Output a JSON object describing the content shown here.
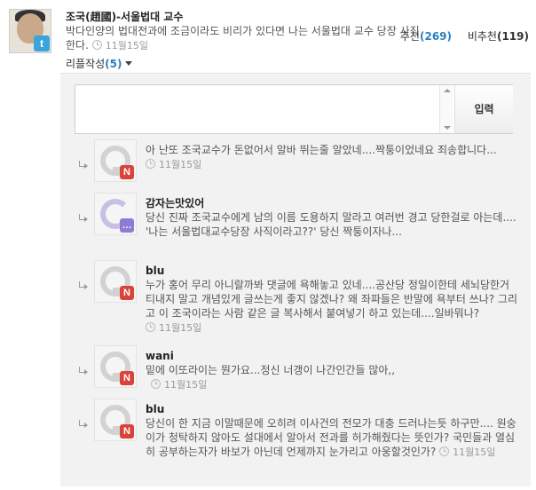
{
  "post": {
    "author": "조국(趙國)-서울법대 교수",
    "avatar_badge": "t",
    "text": "박다인양의 법대전과에 조금이라도 비리가 있다면 나는 서울법대 교수 당장 사직한다.",
    "time": "11월15일",
    "votes": {
      "up_label": "추천",
      "up_count": "(269)",
      "down_label": "비추천",
      "down_count": "(119)"
    }
  },
  "reply_toggle": {
    "label": "리플작성",
    "count": "(5)"
  },
  "reply_input": {
    "value": "",
    "submit_label": "입력"
  },
  "comments": [
    {
      "author": "",
      "badge": "N",
      "text": "아 난또 조국교수가 돈없어서 알바 뛰는줄 알았네....짝퉁이었네요 죄송합니다...",
      "time": "11월15일"
    },
    {
      "author": "감자는맛있어",
      "badge": "…",
      "text": "당신 진짜 조국교수에게 남의 이름 도용하지 말라고 여러번 경고 당한걸로 아는데.... '나는 서울법대교수당장 사직이라고??' 당신 짝퉁이자나...",
      "time": ""
    },
    {
      "author": "blu",
      "badge": "N",
      "text": "누가 홍어 무리 아니랄까봐 댓글에 욕해놓고 있네....공산당 정일이한테 세뇌당한거 티내지 말고 개념있게 글쓰는게 좋지 않겠나? 왜 좌파들은 반말에 욕부터 쓰나? 그리고 이 조국이라는 사람 같은 글 복사해서 붙여넣기 하고 있는데....일바뭐나?",
      "time": "11월15일"
    },
    {
      "author": "wani",
      "badge": "N",
      "text": "밑에 이또라이는 뭔가요...정신 너갱이 나간인간들 많아,,",
      "time": "11월15일"
    },
    {
      "author": "blu",
      "badge": "N",
      "text": "당신이 한 지금 이말때문에 오히려 이사건의 전모가 대충 드러나는듯 하구만.... 원숭이가 청탁하지 않아도 설대에서 알아서 전과를 허가해줬다는 뜻인가? 국민들과 열심히 공부하는자가 바보가 아닌데 언제까지 눈가리고 아웅할것인가?",
      "time": "11월15일"
    }
  ],
  "colors": {
    "accent": "#2a7fc0",
    "panel_bg": "#f2f2f2",
    "nate_red": "#d9433a",
    "talk_purple": "#8f7bd6"
  }
}
